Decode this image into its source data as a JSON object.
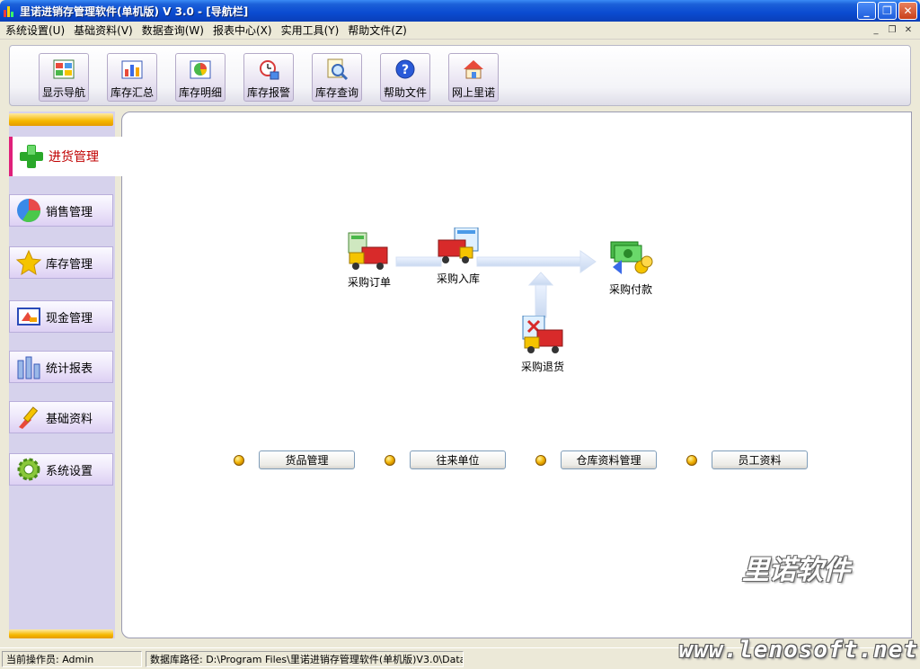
{
  "window": {
    "title": "里诺进销存管理软件(单机版) V 3.0 - [导航栏]",
    "buttons": {
      "minimize": "_",
      "maximize": "❐",
      "close": "✕"
    }
  },
  "menu": {
    "items": [
      "系统设置(U)",
      "基础资料(V)",
      "数据查询(W)",
      "报表中心(X)",
      "实用工具(Y)",
      "帮助文件(Z)"
    ],
    "mdi": {
      "minimize": "_",
      "restore": "❐",
      "close": "✕"
    }
  },
  "toolbar": {
    "buttons": [
      {
        "label": "显示导航",
        "icon": "navigation-icon"
      },
      {
        "label": "库存汇总",
        "icon": "bar-chart-icon"
      },
      {
        "label": "库存明细",
        "icon": "pie-chart-icon"
      },
      {
        "label": "库存报警",
        "icon": "alarm-clock-icon"
      },
      {
        "label": "库存查询",
        "icon": "magnifier-icon"
      },
      {
        "label": "帮助文件",
        "icon": "help-icon"
      },
      {
        "label": "网上里诺",
        "icon": "home-icon"
      }
    ]
  },
  "sidebar": {
    "active": {
      "label": "进货管理",
      "icon": "green-plus-icon"
    },
    "items": [
      {
        "label": "销售管理",
        "icon": "globe-icon"
      },
      {
        "label": "库存管理",
        "icon": "star-icon"
      },
      {
        "label": "现金管理",
        "icon": "cash-icon"
      },
      {
        "label": "统计报表",
        "icon": "report-bars-icon"
      },
      {
        "label": "基础资料",
        "icon": "brush-icon"
      },
      {
        "label": "系统设置",
        "icon": "gear-icon"
      }
    ]
  },
  "flow": {
    "nodes": {
      "order": "采购订单",
      "inbound": "采购入库",
      "payment": "采购付款",
      "return": "采购退货"
    }
  },
  "links": [
    "货品管理",
    "往来单位",
    "仓库资料管理",
    "员工资料"
  ],
  "watermark": {
    "cn": "里诺软件",
    "en": "www.lenosoft.net"
  },
  "status": {
    "operator": "当前操作员: Admin",
    "db_path": "数据库路径: D:\\Program Files\\里诺进销存管理软件(单机版)V3.0\\Data"
  },
  "colors": {
    "title_bar": "#0a4bd0",
    "active_accent": "#e0207a",
    "active_text": "#c00000",
    "nav_bg": "#d6d2ec"
  }
}
